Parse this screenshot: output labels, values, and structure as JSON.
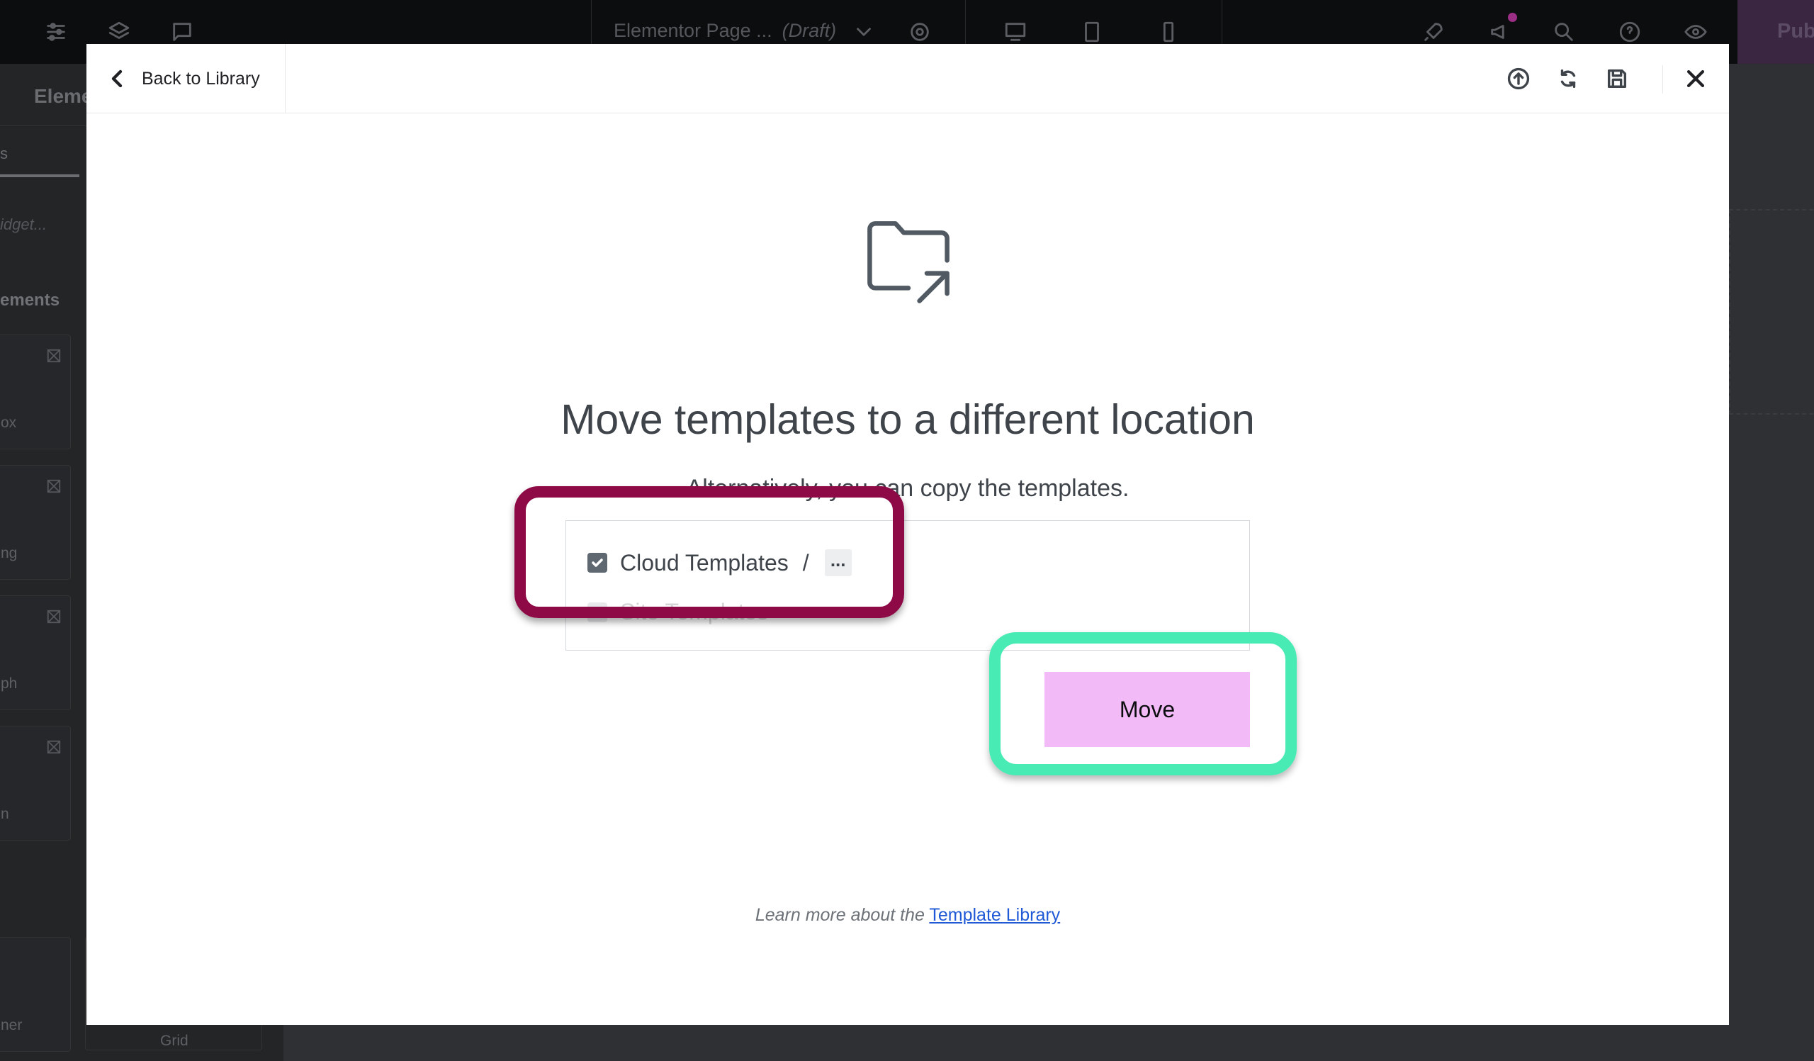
{
  "editor": {
    "page_title": "Elementor Page ...",
    "page_status": "(Draft)",
    "publish_label": "Pub",
    "panel_title": "Eleme",
    "panel_tab": "s",
    "panel_search_placeholder": "idget...",
    "panel_category": "ements",
    "widgets": [
      "ox",
      "ng",
      "ph",
      "n",
      "ner"
    ],
    "widget_right_label": "Grid"
  },
  "modal": {
    "back_label": "Back to Library",
    "title": "Move templates to a different location",
    "subtitle": "Alternatively, you can copy the templates.",
    "location": {
      "selected_folder": "Cloud Templates",
      "separator": "/",
      "more_label": "...",
      "next_folder": "Site Templates"
    },
    "move_button": "Move",
    "footer_text": "Learn more about the",
    "footer_link": "Template Library"
  },
  "annotations": {
    "red_highlight_color": "#8d0a46",
    "green_highlight_color": "#47ebb3",
    "move_button_color": "#f2baf7"
  }
}
